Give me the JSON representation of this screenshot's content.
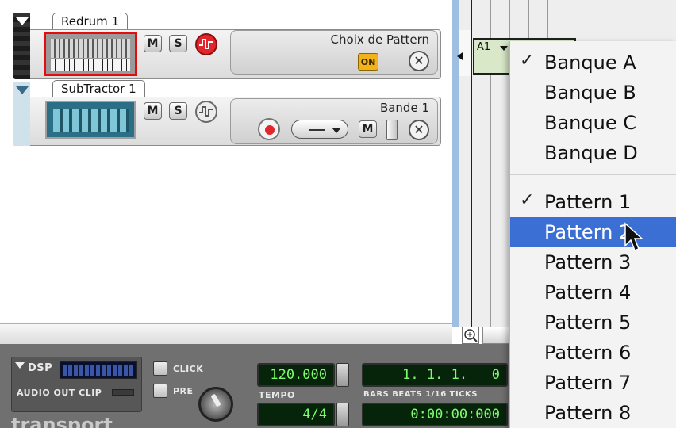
{
  "tracks": [
    {
      "name": "Redrum 1",
      "mute": "M",
      "solo": "S",
      "panel_title": "Choix de Pattern",
      "on_label": "ON"
    },
    {
      "name": "SubTractor 1",
      "mute": "M",
      "solo": "S",
      "panel_title": "Bande 1",
      "mute2": "M"
    }
  ],
  "arrange": {
    "clip_label": "A1"
  },
  "transport": {
    "dsp": "DSP",
    "audio_out_clip": "AUDIO OUT CLIP",
    "click": "CLICK",
    "pre": "PRE",
    "tempo": "120.000",
    "tempo_label": "TEMPO",
    "signature": "4/4",
    "position": "1. 1. 1.   0",
    "position_label": "BARS BEATS 1/16 TICKS",
    "time": "0:00:00:000",
    "logo": "transport"
  },
  "menu": {
    "banks": [
      "Banque A",
      "Banque B",
      "Banque C",
      "Banque D"
    ],
    "patterns": [
      "Pattern 1",
      "Pattern 2",
      "Pattern 3",
      "Pattern 4",
      "Pattern 5",
      "Pattern 6",
      "Pattern 7",
      "Pattern 8"
    ],
    "checked_bank": "Banque A",
    "checked_pattern": "Pattern 1",
    "highlighted": "Pattern 2",
    "check_mark": "✓"
  },
  "colors": {
    "highlight": "#3b6fd4",
    "lcd_text": "#7dfc6e",
    "on_button": "#f2b21b",
    "record": "#e2262b"
  }
}
